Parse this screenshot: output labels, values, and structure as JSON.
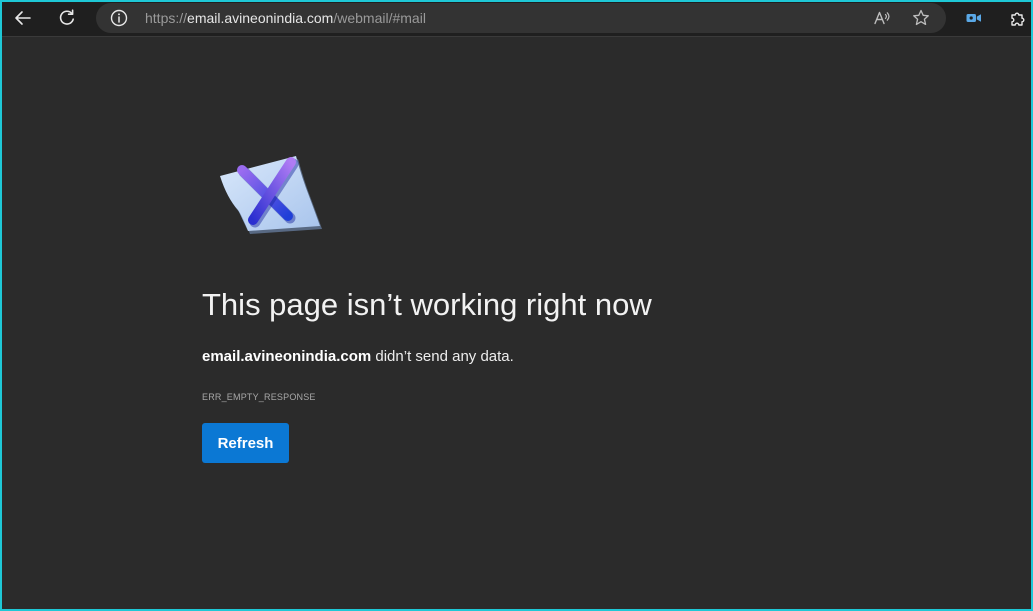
{
  "browser": {
    "back_icon": "back-arrow-icon",
    "reload_icon": "reload-icon",
    "address_bar": {
      "info_icon": "info-icon",
      "url_scheme": "https://",
      "url_host": "email.avineonindia.com",
      "url_path": "/webmail/#mail",
      "read_aloud_icon": "read-aloud-icon",
      "favorite_icon": "star-icon"
    },
    "extensions": [
      "video-camera-icon",
      "puzzle-extension-icon"
    ]
  },
  "error_page": {
    "illustration_icon": "broken-page-x-icon",
    "title": "This page isn’t working right now",
    "message_host": "email.avineonindia.com",
    "message_rest": " didn’t send any data.",
    "error_code": "ERR_EMPTY_RESPONSE",
    "refresh_label": "Refresh"
  },
  "colors": {
    "window_border": "#1ec8d6",
    "page_background": "#2b2b2b",
    "toolbar_background": "#1f1f1f",
    "address_bar_background": "#333333",
    "refresh_button": "#0b78d4"
  }
}
